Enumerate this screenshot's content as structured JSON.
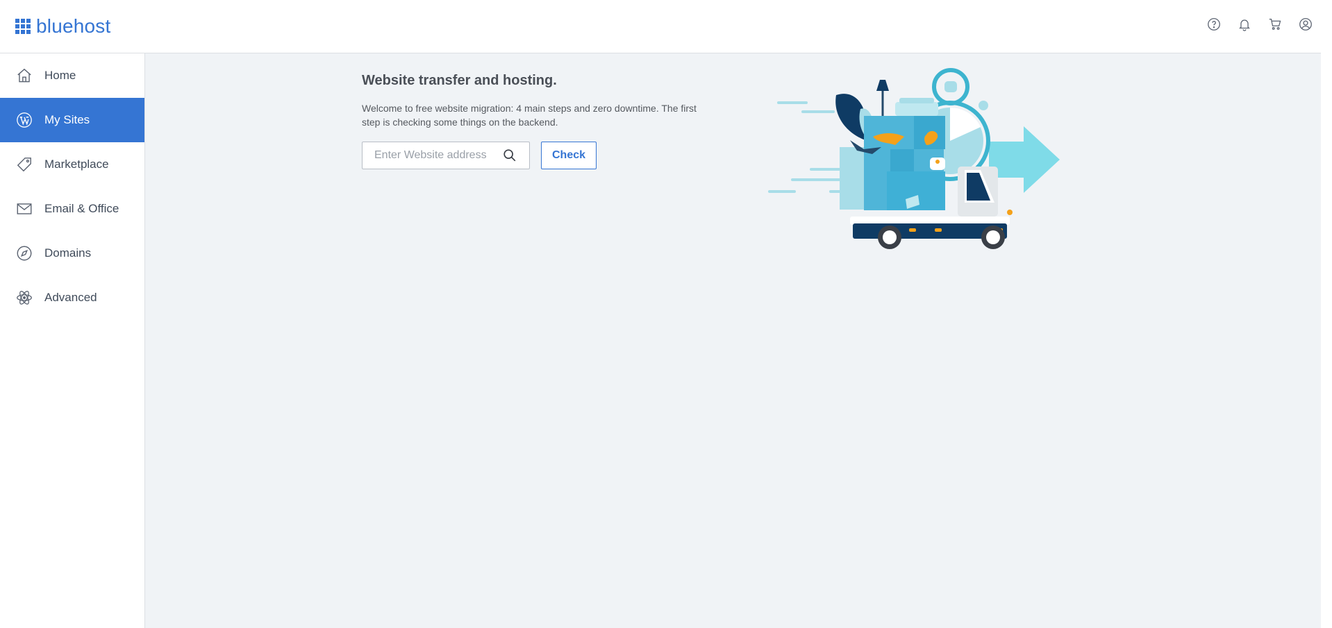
{
  "brand": {
    "name": "bluehost",
    "color": "#3575d3"
  },
  "header_icons": [
    {
      "name": "help-icon"
    },
    {
      "name": "bell-icon"
    },
    {
      "name": "cart-icon"
    },
    {
      "name": "account-icon"
    }
  ],
  "sidebar": {
    "items": [
      {
        "label": "Home",
        "icon": "home-icon",
        "active": false
      },
      {
        "label": "My Sites",
        "icon": "wordpress-icon",
        "active": true
      },
      {
        "label": "Marketplace",
        "icon": "tag-icon",
        "active": false
      },
      {
        "label": "Email & Office",
        "icon": "mail-icon",
        "active": false
      },
      {
        "label": "Domains",
        "icon": "compass-icon",
        "active": false
      },
      {
        "label": "Advanced",
        "icon": "atom-icon",
        "active": false
      }
    ]
  },
  "main": {
    "title": "Website transfer and hosting.",
    "description": "Welcome to free website migration: 4 main steps and zero downtime. The first step is checking some things on the backend.",
    "search": {
      "placeholder": "Enter Website address",
      "value": ""
    },
    "check_label": "Check"
  }
}
